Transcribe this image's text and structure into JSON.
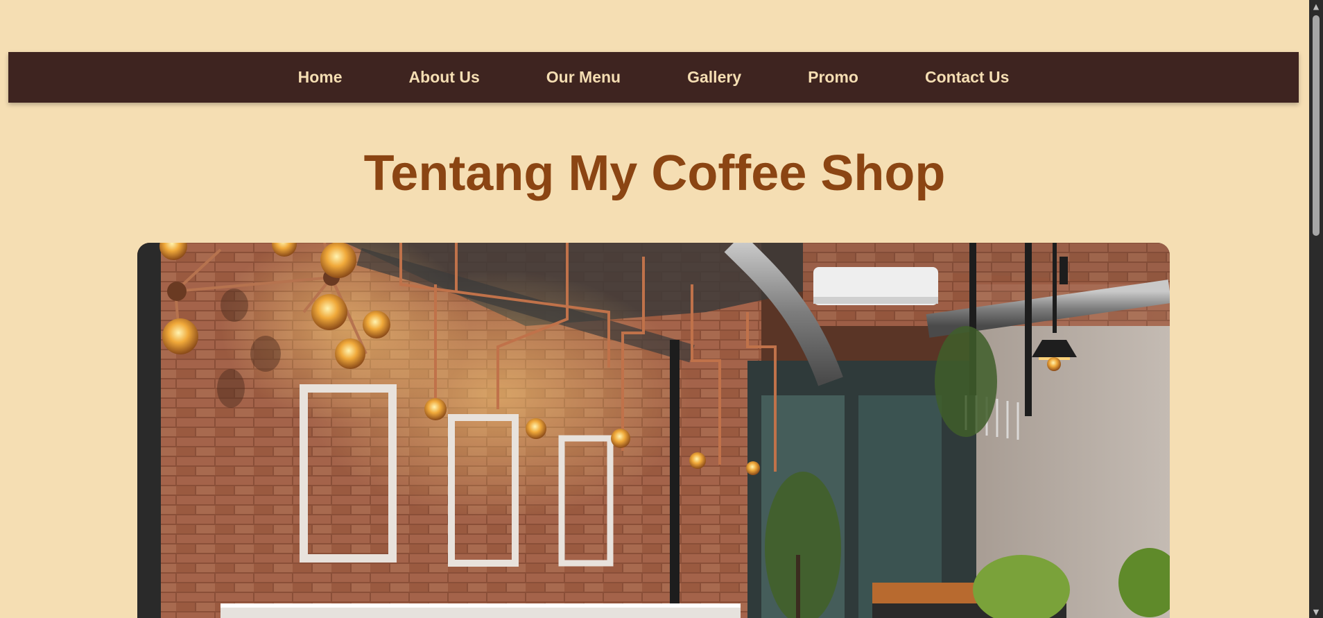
{
  "nav": {
    "items": [
      {
        "label": "Home"
      },
      {
        "label": "About Us"
      },
      {
        "label": "Our Menu"
      },
      {
        "label": "Gallery"
      },
      {
        "label": "Promo"
      },
      {
        "label": "Contact Us"
      }
    ]
  },
  "main": {
    "title": "Tentang My Coffee Shop"
  },
  "colors": {
    "page_background": "#f5deb3",
    "navbar_background": "#3e2420",
    "nav_text": "#f5deb3",
    "title": "#8b4513"
  },
  "icons": {
    "scroll_up": "scroll-up-arrow-icon",
    "scroll_down": "scroll-down-arrow-icon"
  }
}
